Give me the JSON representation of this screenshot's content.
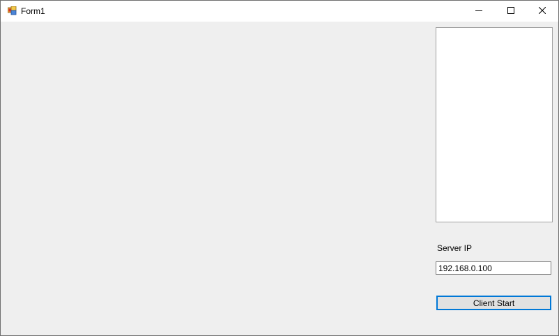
{
  "window": {
    "title": "Form1",
    "icon": "winforms-app-icon",
    "background_color": "#efefef",
    "titlebar_color": "#ffffff"
  },
  "caption_buttons": {
    "minimize": "minimize-icon",
    "maximize": "maximize-icon",
    "close": "close-icon"
  },
  "form": {
    "listbox_items": [],
    "server_ip_label": "Server IP",
    "server_ip_value": "192.168.0.100",
    "client_start_label": "Client Start",
    "focus_color": "#0078d7"
  }
}
